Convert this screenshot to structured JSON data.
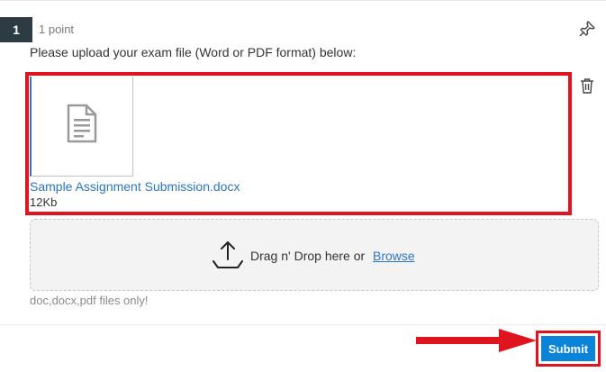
{
  "question": {
    "number": "1",
    "points": "1 point",
    "prompt": "Please upload your exam file (Word or PDF format) below:"
  },
  "file": {
    "name": "Sample Assignment Submission.docx",
    "size": "12Kb",
    "icon": "document-icon"
  },
  "upload": {
    "drop_text": "Drag n' Drop here or",
    "browse_label": "Browse",
    "hint": "doc,docx,pdf files only!"
  },
  "actions": {
    "submit_label": "Submit"
  },
  "colors": {
    "accent": "#0a84d8",
    "link": "#2a76c6",
    "highlight": "#e0141e",
    "badge_bg": "#2d3b45"
  }
}
